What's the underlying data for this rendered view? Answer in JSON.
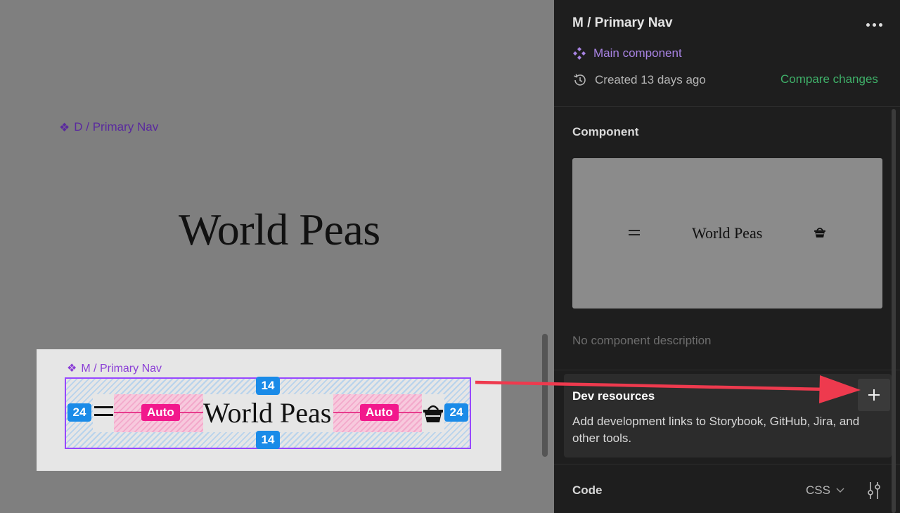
{
  "canvas": {
    "desktop_frame_label": "D / Primary Nav",
    "desktop_title": "World Peas",
    "mobile_frame_label": "M / Primary Nav",
    "mobile_nav_title": "World Peas",
    "spacing": {
      "padding_top": "14",
      "padding_bottom": "14",
      "padding_left": "24",
      "padding_right": "24",
      "gap_left": "Auto",
      "gap_right": "Auto"
    }
  },
  "inspector": {
    "title": "M / Primary Nav",
    "main_component_label": "Main component",
    "created_label": "Created 13 days ago",
    "compare_label": "Compare changes",
    "component_section": "Component",
    "preview_title": "World Peas",
    "no_description": "No component description",
    "dev_resources": {
      "title": "Dev resources",
      "description": "Add development links to Storybook, GitHub, Jira, and other tools."
    },
    "code_section": "Code",
    "code_language": "CSS"
  },
  "colors": {
    "component_purple": "#9747ff",
    "spacing_blue": "#1a8be8",
    "auto_pink": "#f2188c",
    "compare_green": "#3fb069",
    "annotation_arrow": "#ee3a4e"
  },
  "icons": [
    "component-diamond-icon",
    "history-icon",
    "more-icon",
    "hamburger-icon",
    "basket-icon",
    "plus-icon",
    "chevron-down-icon",
    "settings-sliders-icon"
  ]
}
